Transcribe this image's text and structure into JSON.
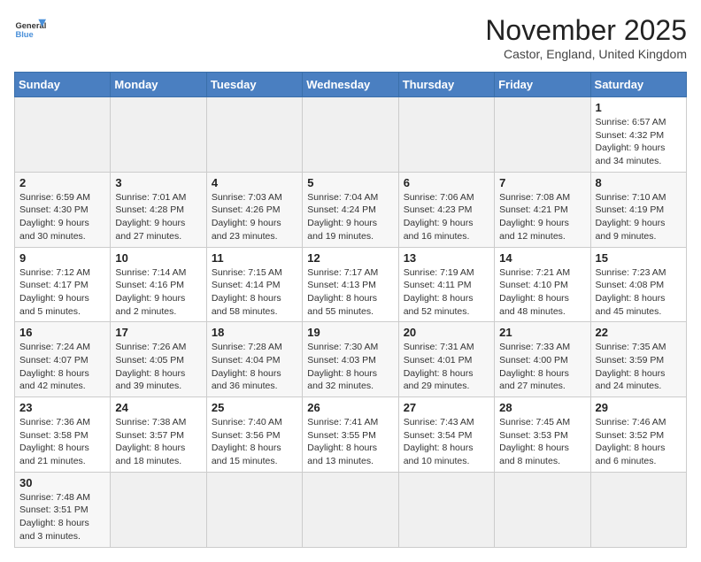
{
  "logo": {
    "text_general": "General",
    "text_blue": "Blue"
  },
  "title": "November 2025",
  "subtitle": "Castor, England, United Kingdom",
  "weekdays": [
    "Sunday",
    "Monday",
    "Tuesday",
    "Wednesday",
    "Thursday",
    "Friday",
    "Saturday"
  ],
  "weeks": [
    {
      "row_class": "row-white",
      "days": [
        {
          "num": "",
          "info": "",
          "empty": true
        },
        {
          "num": "",
          "info": "",
          "empty": true
        },
        {
          "num": "",
          "info": "",
          "empty": true
        },
        {
          "num": "",
          "info": "",
          "empty": true
        },
        {
          "num": "",
          "info": "",
          "empty": true
        },
        {
          "num": "",
          "info": "",
          "empty": true
        },
        {
          "num": "1",
          "info": "Sunrise: 6:57 AM\nSunset: 4:32 PM\nDaylight: 9 hours\nand 34 minutes.",
          "empty": false
        }
      ]
    },
    {
      "row_class": "row-gray",
      "days": [
        {
          "num": "2",
          "info": "Sunrise: 6:59 AM\nSunset: 4:30 PM\nDaylight: 9 hours\nand 30 minutes.",
          "empty": false
        },
        {
          "num": "3",
          "info": "Sunrise: 7:01 AM\nSunset: 4:28 PM\nDaylight: 9 hours\nand 27 minutes.",
          "empty": false
        },
        {
          "num": "4",
          "info": "Sunrise: 7:03 AM\nSunset: 4:26 PM\nDaylight: 9 hours\nand 23 minutes.",
          "empty": false
        },
        {
          "num": "5",
          "info": "Sunrise: 7:04 AM\nSunset: 4:24 PM\nDaylight: 9 hours\nand 19 minutes.",
          "empty": false
        },
        {
          "num": "6",
          "info": "Sunrise: 7:06 AM\nSunset: 4:23 PM\nDaylight: 9 hours\nand 16 minutes.",
          "empty": false
        },
        {
          "num": "7",
          "info": "Sunrise: 7:08 AM\nSunset: 4:21 PM\nDaylight: 9 hours\nand 12 minutes.",
          "empty": false
        },
        {
          "num": "8",
          "info": "Sunrise: 7:10 AM\nSunset: 4:19 PM\nDaylight: 9 hours\nand 9 minutes.",
          "empty": false
        }
      ]
    },
    {
      "row_class": "row-white",
      "days": [
        {
          "num": "9",
          "info": "Sunrise: 7:12 AM\nSunset: 4:17 PM\nDaylight: 9 hours\nand 5 minutes.",
          "empty": false
        },
        {
          "num": "10",
          "info": "Sunrise: 7:14 AM\nSunset: 4:16 PM\nDaylight: 9 hours\nand 2 minutes.",
          "empty": false
        },
        {
          "num": "11",
          "info": "Sunrise: 7:15 AM\nSunset: 4:14 PM\nDaylight: 8 hours\nand 58 minutes.",
          "empty": false
        },
        {
          "num": "12",
          "info": "Sunrise: 7:17 AM\nSunset: 4:13 PM\nDaylight: 8 hours\nand 55 minutes.",
          "empty": false
        },
        {
          "num": "13",
          "info": "Sunrise: 7:19 AM\nSunset: 4:11 PM\nDaylight: 8 hours\nand 52 minutes.",
          "empty": false
        },
        {
          "num": "14",
          "info": "Sunrise: 7:21 AM\nSunset: 4:10 PM\nDaylight: 8 hours\nand 48 minutes.",
          "empty": false
        },
        {
          "num": "15",
          "info": "Sunrise: 7:23 AM\nSunset: 4:08 PM\nDaylight: 8 hours\nand 45 minutes.",
          "empty": false
        }
      ]
    },
    {
      "row_class": "row-gray",
      "days": [
        {
          "num": "16",
          "info": "Sunrise: 7:24 AM\nSunset: 4:07 PM\nDaylight: 8 hours\nand 42 minutes.",
          "empty": false
        },
        {
          "num": "17",
          "info": "Sunrise: 7:26 AM\nSunset: 4:05 PM\nDaylight: 8 hours\nand 39 minutes.",
          "empty": false
        },
        {
          "num": "18",
          "info": "Sunrise: 7:28 AM\nSunset: 4:04 PM\nDaylight: 8 hours\nand 36 minutes.",
          "empty": false
        },
        {
          "num": "19",
          "info": "Sunrise: 7:30 AM\nSunset: 4:03 PM\nDaylight: 8 hours\nand 32 minutes.",
          "empty": false
        },
        {
          "num": "20",
          "info": "Sunrise: 7:31 AM\nSunset: 4:01 PM\nDaylight: 8 hours\nand 29 minutes.",
          "empty": false
        },
        {
          "num": "21",
          "info": "Sunrise: 7:33 AM\nSunset: 4:00 PM\nDaylight: 8 hours\nand 27 minutes.",
          "empty": false
        },
        {
          "num": "22",
          "info": "Sunrise: 7:35 AM\nSunset: 3:59 PM\nDaylight: 8 hours\nand 24 minutes.",
          "empty": false
        }
      ]
    },
    {
      "row_class": "row-white",
      "days": [
        {
          "num": "23",
          "info": "Sunrise: 7:36 AM\nSunset: 3:58 PM\nDaylight: 8 hours\nand 21 minutes.",
          "empty": false
        },
        {
          "num": "24",
          "info": "Sunrise: 7:38 AM\nSunset: 3:57 PM\nDaylight: 8 hours\nand 18 minutes.",
          "empty": false
        },
        {
          "num": "25",
          "info": "Sunrise: 7:40 AM\nSunset: 3:56 PM\nDaylight: 8 hours\nand 15 minutes.",
          "empty": false
        },
        {
          "num": "26",
          "info": "Sunrise: 7:41 AM\nSunset: 3:55 PM\nDaylight: 8 hours\nand 13 minutes.",
          "empty": false
        },
        {
          "num": "27",
          "info": "Sunrise: 7:43 AM\nSunset: 3:54 PM\nDaylight: 8 hours\nand 10 minutes.",
          "empty": false
        },
        {
          "num": "28",
          "info": "Sunrise: 7:45 AM\nSunset: 3:53 PM\nDaylight: 8 hours\nand 8 minutes.",
          "empty": false
        },
        {
          "num": "29",
          "info": "Sunrise: 7:46 AM\nSunset: 3:52 PM\nDaylight: 8 hours\nand 6 minutes.",
          "empty": false
        }
      ]
    },
    {
      "row_class": "row-gray",
      "days": [
        {
          "num": "30",
          "info": "Sunrise: 7:48 AM\nSunset: 3:51 PM\nDaylight: 8 hours\nand 3 minutes.",
          "empty": false
        },
        {
          "num": "",
          "info": "",
          "empty": true
        },
        {
          "num": "",
          "info": "",
          "empty": true
        },
        {
          "num": "",
          "info": "",
          "empty": true
        },
        {
          "num": "",
          "info": "",
          "empty": true
        },
        {
          "num": "",
          "info": "",
          "empty": true
        },
        {
          "num": "",
          "info": "",
          "empty": true
        }
      ]
    }
  ]
}
